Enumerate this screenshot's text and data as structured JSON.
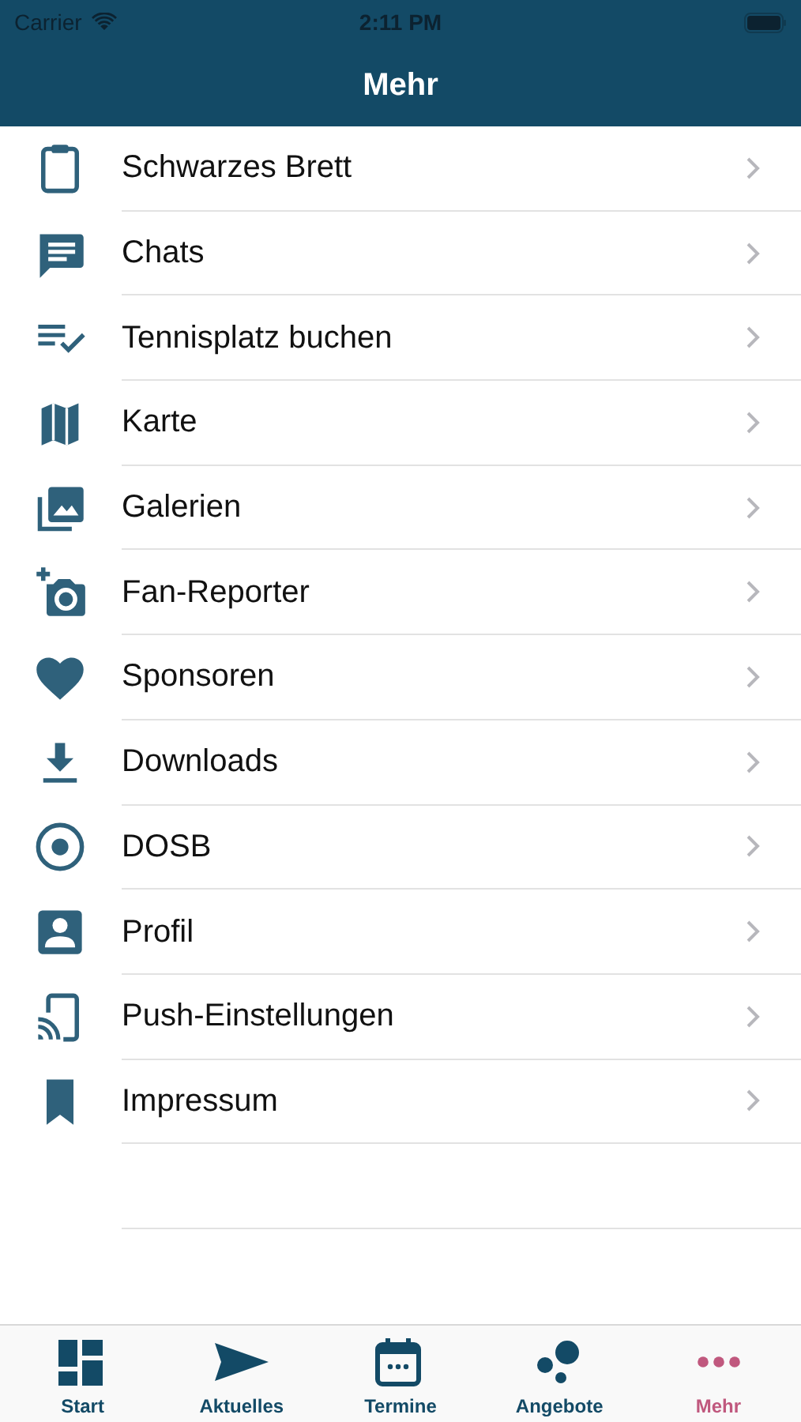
{
  "status_bar": {
    "carrier": "Carrier",
    "time": "2:11 PM"
  },
  "nav_bar": {
    "title": "Mehr"
  },
  "menu_items": [
    {
      "label": "Schwarzes Brett"
    },
    {
      "label": "Chats"
    },
    {
      "label": "Tennisplatz buchen"
    },
    {
      "label": "Karte"
    },
    {
      "label": "Galerien"
    },
    {
      "label": "Fan-Reporter"
    },
    {
      "label": "Sponsoren"
    },
    {
      "label": "Downloads"
    },
    {
      "label": "DOSB"
    },
    {
      "label": "Profil"
    },
    {
      "label": "Push-Einstellungen"
    },
    {
      "label": "Impressum"
    }
  ],
  "tab_bar": [
    {
      "label": "Start",
      "selected": false
    },
    {
      "label": "Aktuelles",
      "selected": false
    },
    {
      "label": "Termine",
      "selected": false
    },
    {
      "label": "Angebote",
      "selected": false
    },
    {
      "label": "Mehr",
      "selected": true
    }
  ]
}
